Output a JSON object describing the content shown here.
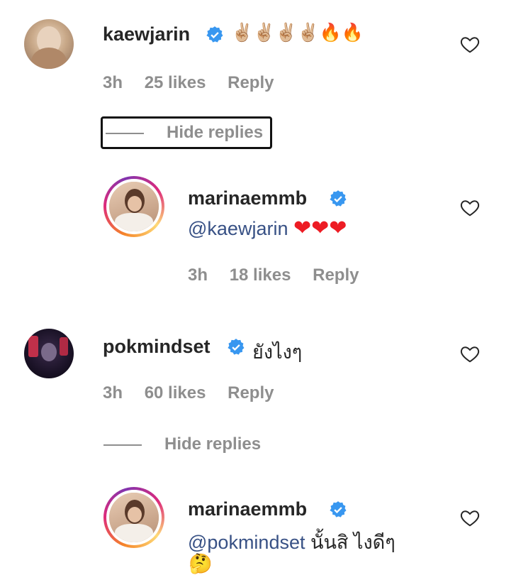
{
  "comments": [
    {
      "username": "kaewjarin",
      "text": "✌🏼✌🏼✌🏼✌🏼🔥🔥",
      "time": "3h",
      "likes": "25 likes",
      "reply": "Reply",
      "hide_replies": "Hide replies",
      "replies": [
        {
          "username": "marinaemmb",
          "mention": "@kaewjarin",
          "text": "❤❤❤",
          "time": "3h",
          "likes": "18 likes",
          "reply": "Reply"
        }
      ]
    },
    {
      "username": "pokmindset",
      "text": "ยังไงๆ",
      "time": "3h",
      "likes": "60 likes",
      "reply": "Reply",
      "hide_replies": "Hide replies",
      "replies": [
        {
          "username": "marinaemmb",
          "mention": "@pokmindset",
          "text": "นั้นสิ ไงดีๆ",
          "emoji": "🤔"
        }
      ]
    }
  ],
  "icons": {
    "verified": "verified-badge-icon",
    "like": "heart-outline-icon"
  },
  "colors": {
    "verified": "#3897f0",
    "mention": "#385185",
    "meta": "#8e8e8e",
    "heart": "#ed1c24"
  }
}
